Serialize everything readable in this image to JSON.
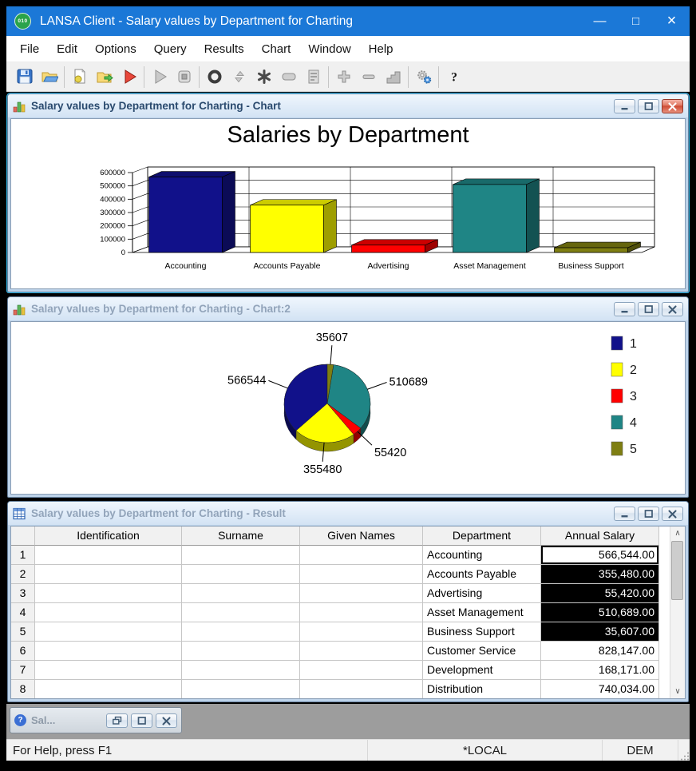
{
  "window": {
    "title": "LANSA Client - Salary values by Department for Charting",
    "app_icon_text": "010",
    "controls": {
      "minimize": "—",
      "maximize": "□",
      "close": "×"
    }
  },
  "menu": {
    "items": [
      "File",
      "Edit",
      "Options",
      "Query",
      "Results",
      "Chart",
      "Window",
      "Help"
    ]
  },
  "toolbar": {
    "groups": [
      [
        "save-icon",
        "open-icon"
      ],
      [
        "new-document-icon",
        "open-folder-icon",
        "run-icon"
      ],
      [
        "play-icon",
        "stop-icon"
      ],
      [
        "record-icon",
        "sort-arrows-icon",
        "asterisk-icon",
        "field-icon",
        "report-icon"
      ],
      [
        "add-icon",
        "remove-icon",
        "chart-steps-icon"
      ],
      [
        "gears-icon"
      ],
      [
        "help-icon"
      ]
    ],
    "help_glyph": "?"
  },
  "windows": {
    "chart": {
      "title": "Salary values by Department for Charting - Chart"
    },
    "chart2": {
      "title": "Salary values by Department for Charting - Chart:2"
    },
    "result": {
      "title": "Salary values by Department for Charting - Result"
    }
  },
  "chart_data": [
    {
      "type": "bar",
      "variant": "3d-column",
      "title": "Salaries by Department",
      "categories": [
        "Accounting",
        "Accounts Payable",
        "Advertising",
        "Asset Management",
        "Business Support"
      ],
      "values": [
        566544,
        355480,
        55420,
        510689,
        35607
      ],
      "colors": [
        "#11118a",
        "#ffff00",
        "#ff0000",
        "#1f8585",
        "#7e7e12"
      ],
      "xlabel": "",
      "ylabel": "",
      "ylim": [
        0,
        600000
      ],
      "yticks": [
        "0",
        "100000",
        "200000",
        "300000",
        "400000",
        "500000",
        "600000"
      ],
      "grid": true,
      "legend": "none"
    },
    {
      "type": "pie",
      "variant": "3d",
      "values": [
        566544,
        355480,
        55420,
        510689,
        35607
      ],
      "labels": [
        "566544",
        "355480",
        "55420",
        "510689",
        "35607"
      ],
      "colors": [
        "#11118a",
        "#ffff00",
        "#ff0000",
        "#1f8585",
        "#7e7e12"
      ],
      "start_angle": 90,
      "direction": "counterclockwise",
      "legend_position": "right",
      "legend": [
        "1",
        "2",
        "3",
        "4",
        "5"
      ]
    }
  ],
  "table": {
    "columns": [
      "",
      "Identification",
      "Surname",
      "Given Names",
      "Department",
      "Annual Salary"
    ],
    "rows": [
      {
        "num": "1",
        "identification": "",
        "surname": "",
        "given_names": "",
        "department": "Accounting",
        "annual_salary": "566,544.00",
        "state": "current"
      },
      {
        "num": "2",
        "identification": "",
        "surname": "",
        "given_names": "",
        "department": "Accounts Payable",
        "annual_salary": "355,480.00",
        "state": "selected"
      },
      {
        "num": "3",
        "identification": "",
        "surname": "",
        "given_names": "",
        "department": "Advertising",
        "annual_salary": "55,420.00",
        "state": "selected"
      },
      {
        "num": "4",
        "identification": "",
        "surname": "",
        "given_names": "",
        "department": "Asset Management",
        "annual_salary": "510,689.00",
        "state": "selected"
      },
      {
        "num": "5",
        "identification": "",
        "surname": "",
        "given_names": "",
        "department": "Business Support",
        "annual_salary": "35,607.00",
        "state": "selected"
      },
      {
        "num": "6",
        "identification": "",
        "surname": "",
        "given_names": "",
        "department": "Customer Service",
        "annual_salary": "828,147.00",
        "state": "normal"
      },
      {
        "num": "7",
        "identification": "",
        "surname": "",
        "given_names": "",
        "department": "Development",
        "annual_salary": "168,171.00",
        "state": "normal"
      },
      {
        "num": "8",
        "identification": "",
        "surname": "",
        "given_names": "",
        "department": "Distribution",
        "annual_salary": "740,034.00",
        "state": "normal"
      }
    ]
  },
  "taskbar": {
    "minimized_window_label": "Sal...",
    "minimized_icon_glyph": "?"
  },
  "status_bar": {
    "help_text": "For Help, press F1",
    "partition": "*LOCAL",
    "user": "DEM"
  }
}
